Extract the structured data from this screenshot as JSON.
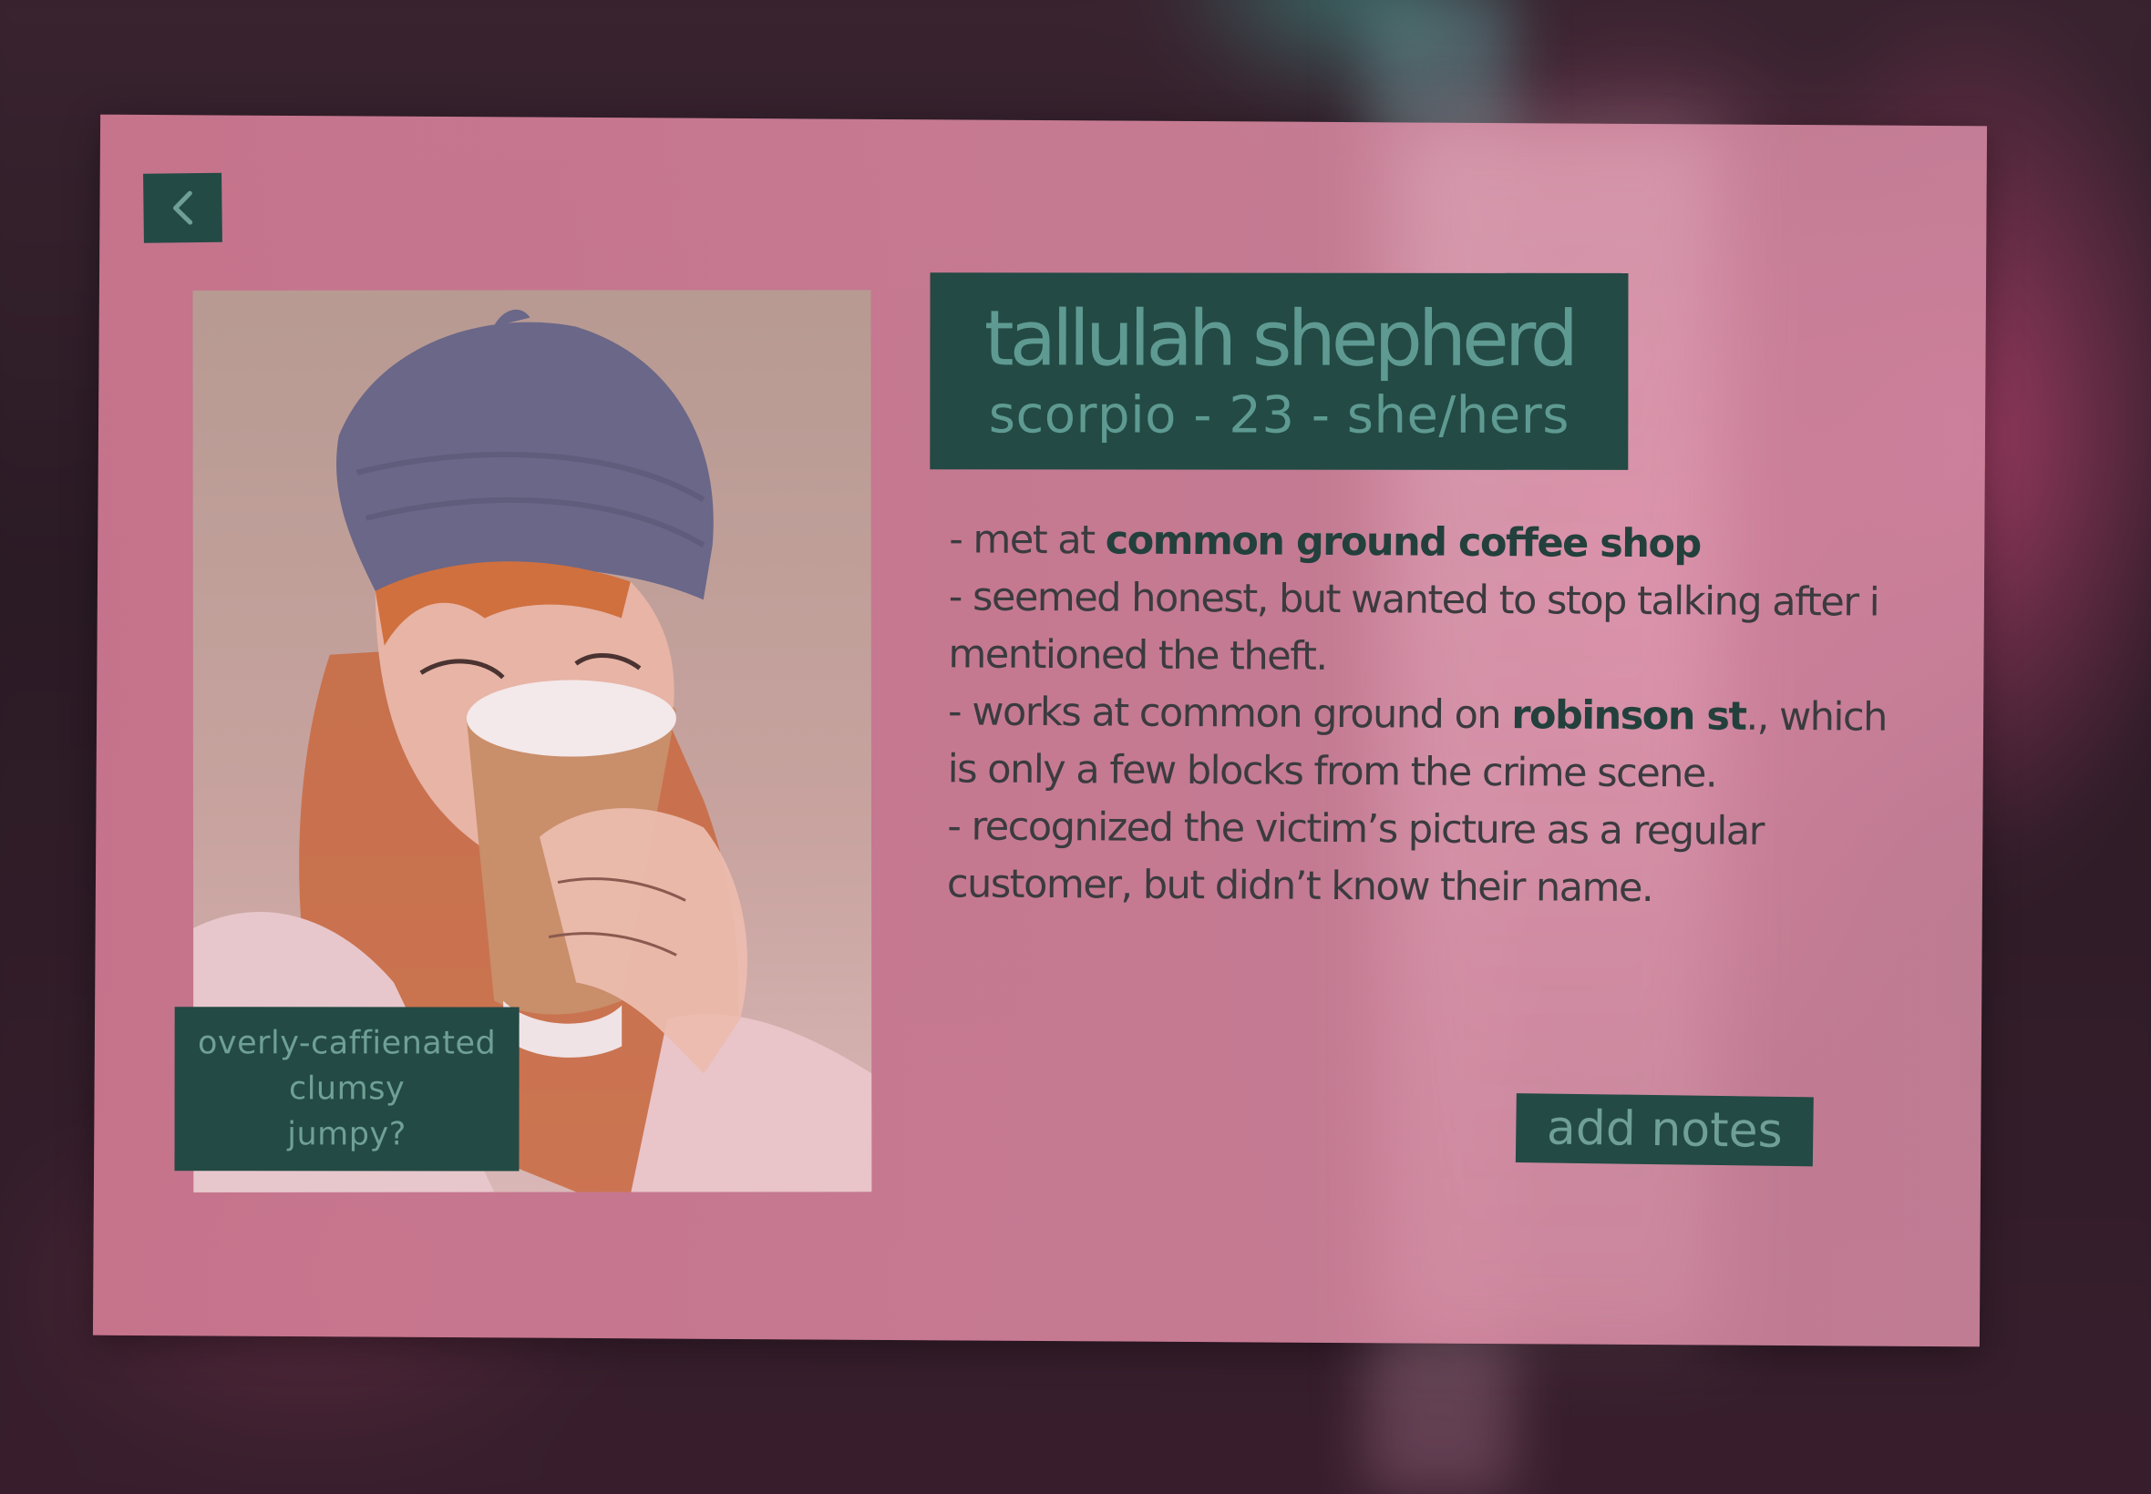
{
  "back_button": {
    "icon": "chevron-left-icon"
  },
  "profile": {
    "name": "tallulah shepherd",
    "subtitle": "scorpio - 23 - she/hers",
    "traits": [
      "overly-caffienated",
      "clumsy",
      "jumpy?"
    ]
  },
  "notes": [
    {
      "pre": "- met at ",
      "bold": "common ground coffee shop",
      "post": ""
    },
    {
      "pre": "- seemed honest, but wanted to stop talking after i mentioned the theft.",
      "bold": "",
      "post": ""
    },
    {
      "pre": "- works at common ground on ",
      "bold": "robinson st",
      "post": "., which is only a few blocks from the crime scene."
    },
    {
      "pre": "- recognized the victim’s picture as a regular customer, but didn’t know their name.",
      "bold": "",
      "post": ""
    }
  ],
  "add_notes_label": "add notes",
  "colors": {
    "card_pink": "#cd7891",
    "dark_teal": "#234a44",
    "teal_text": "#5e9a91",
    "note_text": "#3b3b3f"
  }
}
